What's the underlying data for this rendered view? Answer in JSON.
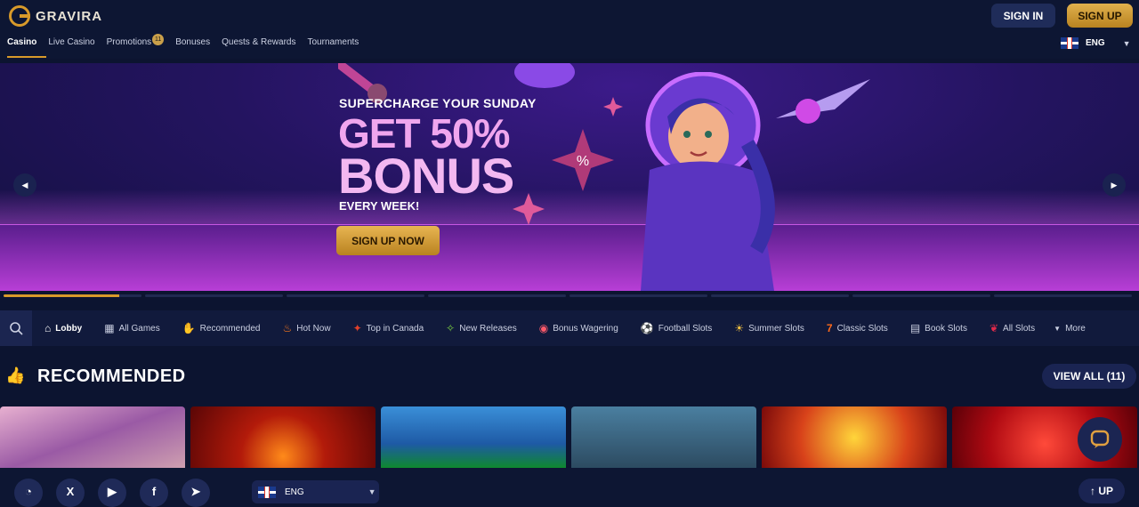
{
  "brand": {
    "name": "GRAVIRA"
  },
  "nav": {
    "items": [
      "Casino",
      "Live Casino",
      "Promotions",
      "Bonuses",
      "Quests & Rewards",
      "Tournaments"
    ],
    "promotions_badge": "11"
  },
  "auth": {
    "signin_label": "SIGN IN",
    "signup_label": "SIGN UP"
  },
  "language": {
    "code": "ENG"
  },
  "banner": {
    "subtitle": "SUPERCHARGE YOUR SUNDAY",
    "title_line1": "GET 50%",
    "title_line2": "BONUS",
    "tagline": "EVERY WEEK!",
    "cta_label": "SIGN UP NOW",
    "slide_count": 8,
    "active_slide": 1
  },
  "categories": [
    {
      "label": "Lobby",
      "icon": "house-icon"
    },
    {
      "label": "All Games",
      "icon": "grid-icon"
    },
    {
      "label": "Recommended",
      "icon": "thumbs-up-icon"
    },
    {
      "label": "Hot Now",
      "icon": "fire-icon"
    },
    {
      "label": "Top in Canada",
      "icon": "maple-leaf-icon"
    },
    {
      "label": "New Releases",
      "icon": "sparkle-icon"
    },
    {
      "label": "Bonus Wagering",
      "icon": "bonus-icon"
    },
    {
      "label": "Football Slots",
      "icon": "football-icon"
    },
    {
      "label": "Summer Slots",
      "icon": "sun-icon"
    },
    {
      "label": "Classic Slots",
      "icon": "seven-icon"
    },
    {
      "label": "Book Slots",
      "icon": "book-icon"
    },
    {
      "label": "All Slots",
      "icon": "cherry-icon"
    },
    {
      "label": "More",
      "icon": "chevron-down-icon"
    }
  ],
  "recommended": {
    "title": "RECOMMENDED",
    "view_all_label": "VIEW ALL (11)"
  },
  "footer": {
    "socials": [
      "whatsapp-icon",
      "x-icon",
      "youtube-icon",
      "facebook-icon",
      "telegram-icon"
    ],
    "up_label": "UP"
  },
  "colors": {
    "accent": "#d89a2a",
    "background": "#0c1430",
    "banner": "#3c1a8a"
  }
}
